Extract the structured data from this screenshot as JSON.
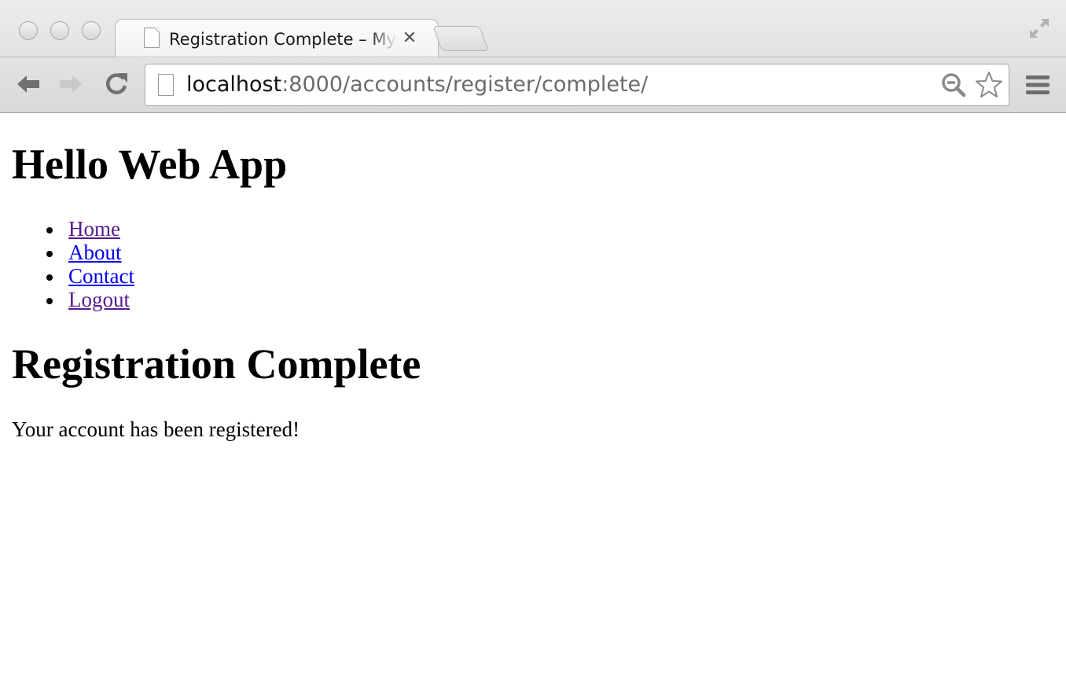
{
  "browser": {
    "tab_title": "Registration Complete – My Web App",
    "tab_close_glyph": "✕",
    "url_host": "localhost",
    "url_rest": ":8000/accounts/register/complete/",
    "icons": {
      "back": "back-arrow-icon",
      "forward": "forward-arrow-icon",
      "reload": "reload-icon",
      "page": "page-icon",
      "zoom": "zoom-out-icon",
      "bookmark": "star-icon",
      "menu": "hamburger-menu-icon",
      "fullscreen": "fullscreen-icon"
    }
  },
  "page": {
    "site_title": "Hello Web App",
    "nav": [
      {
        "label": "Home",
        "visited": true
      },
      {
        "label": "About",
        "visited": false
      },
      {
        "label": "Contact",
        "visited": false
      },
      {
        "label": "Logout",
        "visited": true
      }
    ],
    "heading": "Registration Complete",
    "message": "Your account has been registered!"
  },
  "colors": {
    "visited_link": "#551a8b",
    "unvisited_link": "#0000ee",
    "text": "#000000",
    "url_host": "#111111",
    "url_rest": "#6b6b6b"
  }
}
